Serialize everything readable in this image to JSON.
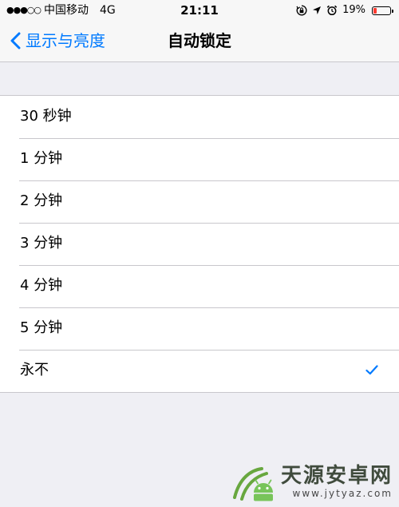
{
  "status_bar": {
    "signal": "●●●○○",
    "carrier": "中国移动",
    "network": "4G",
    "time": "21:11",
    "battery_percent": "19%",
    "battery_level": 0.19,
    "battery_color": "#ff3b30",
    "icons": [
      "orientation-lock-icon",
      "location-arrow-icon",
      "alarm-icon"
    ]
  },
  "nav": {
    "back_label": "显示与亮度",
    "title": "自动锁定",
    "accent_color": "#007aff"
  },
  "options": [
    {
      "label": "30 秒钟",
      "selected": false
    },
    {
      "label": "1 分钟",
      "selected": false
    },
    {
      "label": "2 分钟",
      "selected": false
    },
    {
      "label": "3 分钟",
      "selected": false
    },
    {
      "label": "4 分钟",
      "selected": false
    },
    {
      "label": "5 分钟",
      "selected": false
    },
    {
      "label": "永不",
      "selected": true
    }
  ],
  "watermark": {
    "text": "天源安卓网",
    "url": "www.jytyaz.com"
  }
}
